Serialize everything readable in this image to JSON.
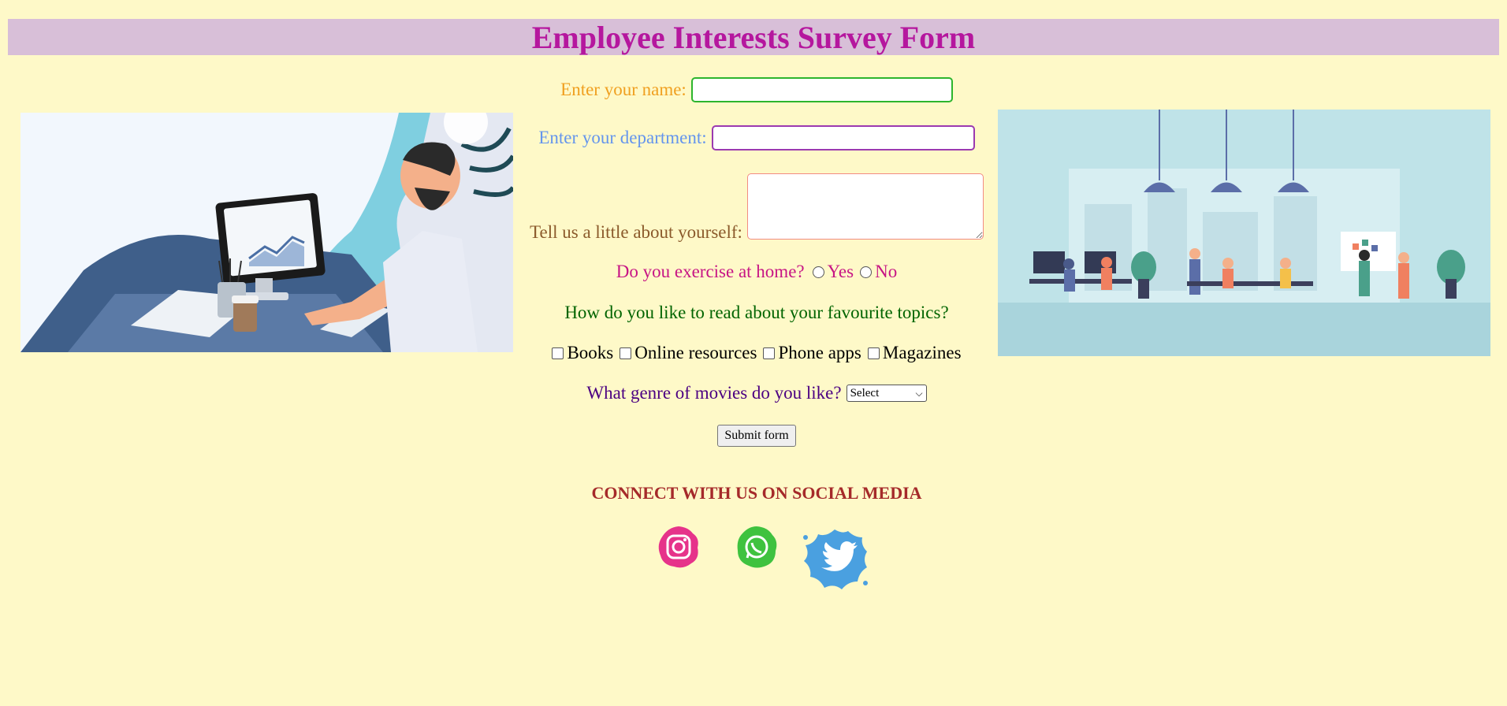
{
  "header": {
    "title": "Employee Interests Survey Form"
  },
  "form": {
    "name_label": "Enter your name:",
    "name_value": "",
    "department_label": "Enter your department:",
    "department_value": "",
    "about_label": "Tell us a little about yourself:",
    "about_value": "",
    "exercise_question": "Do you exercise at home?",
    "exercise_options": [
      "Yes",
      "No"
    ],
    "reading_question": "How do you like to read about your favourite topics?",
    "reading_options": [
      "Books",
      "Online resources",
      "Phone apps",
      "Magazines"
    ],
    "movies_question": "What genre of movies do you like?",
    "movies_selected": "Select",
    "submit_label": "Submit form"
  },
  "social": {
    "title": "CONNECT WITH US ON SOCIAL MEDIA",
    "icons": [
      "instagram-icon",
      "whatsapp-icon",
      "twitter-icon"
    ]
  },
  "colors": {
    "background": "#fef9c8",
    "header_bg": "#d8bfd8",
    "title": "#b5179e",
    "name_label": "#f0a020",
    "department_label": "#6495ed",
    "about_label": "#8b5a2b",
    "exercise_label": "#c71585",
    "reading_label": "#006400",
    "movies_label": "#4b0082",
    "social_title": "#a52a2a"
  }
}
